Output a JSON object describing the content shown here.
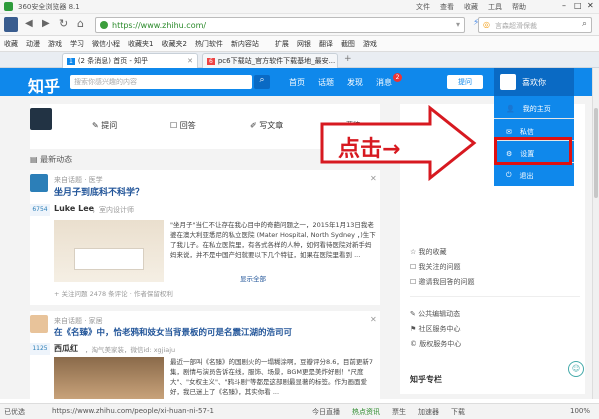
{
  "browser": {
    "title": "360安全浏览器 8.1",
    "menu": [
      "文件",
      "查看",
      "收藏",
      "工具",
      "帮助"
    ],
    "url": "https://www.zhihu.com/",
    "search_placeholder": "言森超滑保裁"
  },
  "favorites": [
    "收藏",
    "动漫",
    "游戏",
    "学习",
    "微信小程",
    "收藏夹1",
    "收藏夹2",
    "热门软件",
    "新内容站"
  ],
  "favorites_right": [
    "扩展",
    "网银",
    "翻译",
    "截图",
    "游戏"
  ],
  "tabs": [
    {
      "badge": "1",
      "label": "(2 条消息) 首页 - 知乎"
    },
    {
      "badge": "6",
      "label": "pc6下载站_官方软件下载基地_最安..."
    }
  ],
  "zhihu": {
    "logo": "知乎",
    "search_placeholder": "搜索你感兴趣的内容",
    "nav": [
      "首页",
      "话题",
      "发现",
      "消息"
    ],
    "msg_count": "2",
    "ask_button": "提问",
    "username": "喜欢你"
  },
  "menu": {
    "items": [
      "我的主页",
      "私信",
      "设置",
      "退出"
    ]
  },
  "annotation": {
    "text": "点击→"
  },
  "post_bar": {
    "ask": "提问",
    "answer": "回答",
    "write": "写文章",
    "draft": "草稿"
  },
  "feed": {
    "heading": "最新动态",
    "item1": {
      "source": "来自话题 · 医学",
      "question": "坐月子到底科不科学？",
      "votes": "6754",
      "author": "Luke Lee",
      "author_desc": "，室内设计师",
      "excerpt": "\"坐月子\"当仁不让存在我心目中的奇葩问题之一，2015年1月13日我老婆在澳大利亚悉尼的私立医院 (Mater Hospital, North Sydney ，)生下了我儿子。在私立医院里，有各式各样的人种，如何看待医院对新手妈妈来说，并不是中国产妇就要以下几个特征，如果在医院里看到 ...",
      "more": "显示全部",
      "footer": "+ 关注问题   2478 条评论 · 作者保留权利"
    },
    "item2": {
      "source": "来自话题 · 家居",
      "question": "在《名臻》中，恰老鸦和妓女当背景板的可是名震江湖的浩司可",
      "votes": "1125",
      "author": "西瓜红",
      "author_desc": "，淘气美家装，微信id: xgjiaju",
      "excerpt": "最近一部叫《名臻》的国剧火的一塌糊涂啊，豆瓣评分8.6，目前更新7集，剧情与演员告诉在线，服饰、场景，BGM更是美炸好剧！\"尺度大\"、\"女权主义\"、\"鸦斗剧\"等都是这部剧最显著的标签。作为画面爱好，我已迷上了《名臻》，其实你看 ..."
    }
  },
  "sidebar": {
    "top_items": [
      "我的收藏",
      "我关注的问题",
      "邀请我回答的问题"
    ],
    "bottom_items": [
      "公共编辑动态",
      "社区服务中心",
      "版权服务中心"
    ],
    "section": "知乎专栏"
  },
  "status": {
    "left": "已优选",
    "url": "https://www.zhihu.com/people/xi-huan-ni-57-1",
    "right": [
      "今日直播",
      "热点资讯",
      "票生",
      "加速器",
      "下载"
    ],
    "zoom": "100%"
  }
}
